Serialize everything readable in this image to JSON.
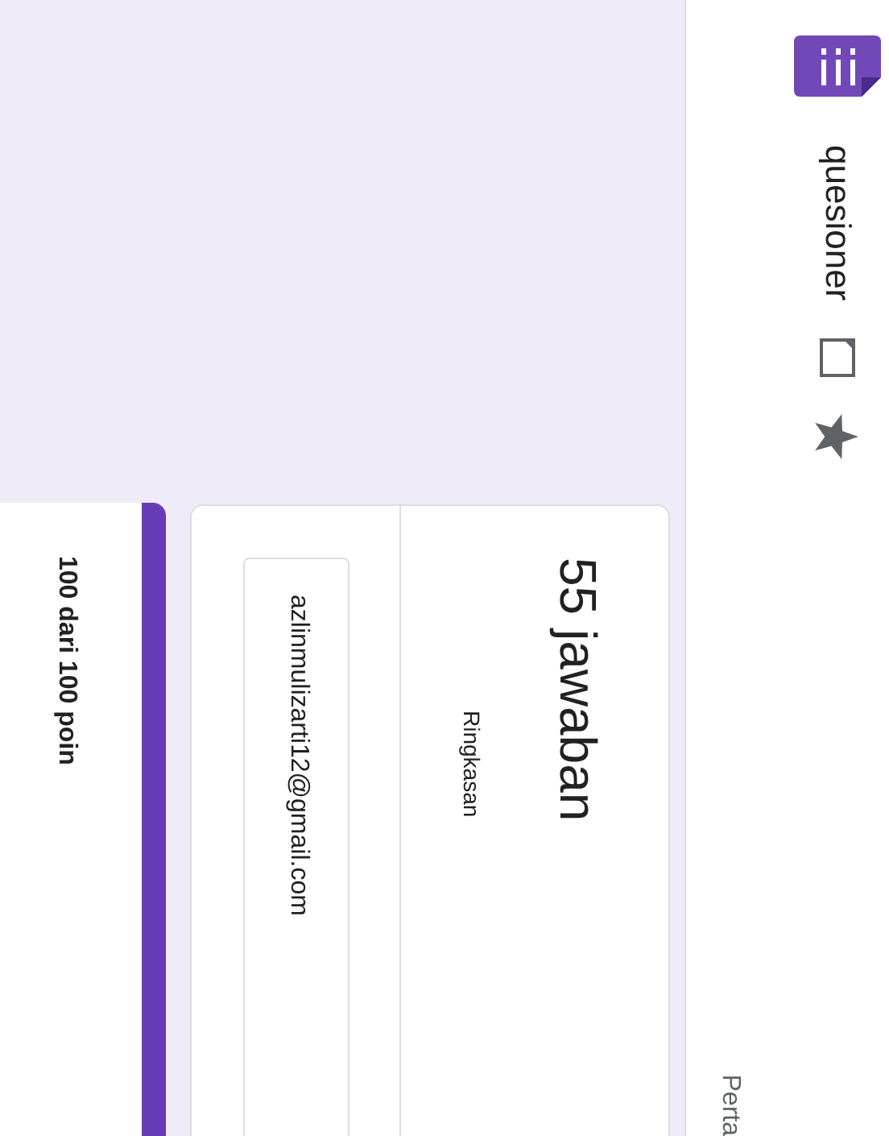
{
  "header": {
    "title": "quesioner",
    "tabs": [
      {
        "label": "Perta",
        "selected": false
      }
    ]
  },
  "summary_card": {
    "count": "55 jawaban",
    "tab": "Ringkasan",
    "respondent": "azlinmulizarti12@gmail.com"
  },
  "score_card": {
    "score": "100 dari 100 poin"
  }
}
